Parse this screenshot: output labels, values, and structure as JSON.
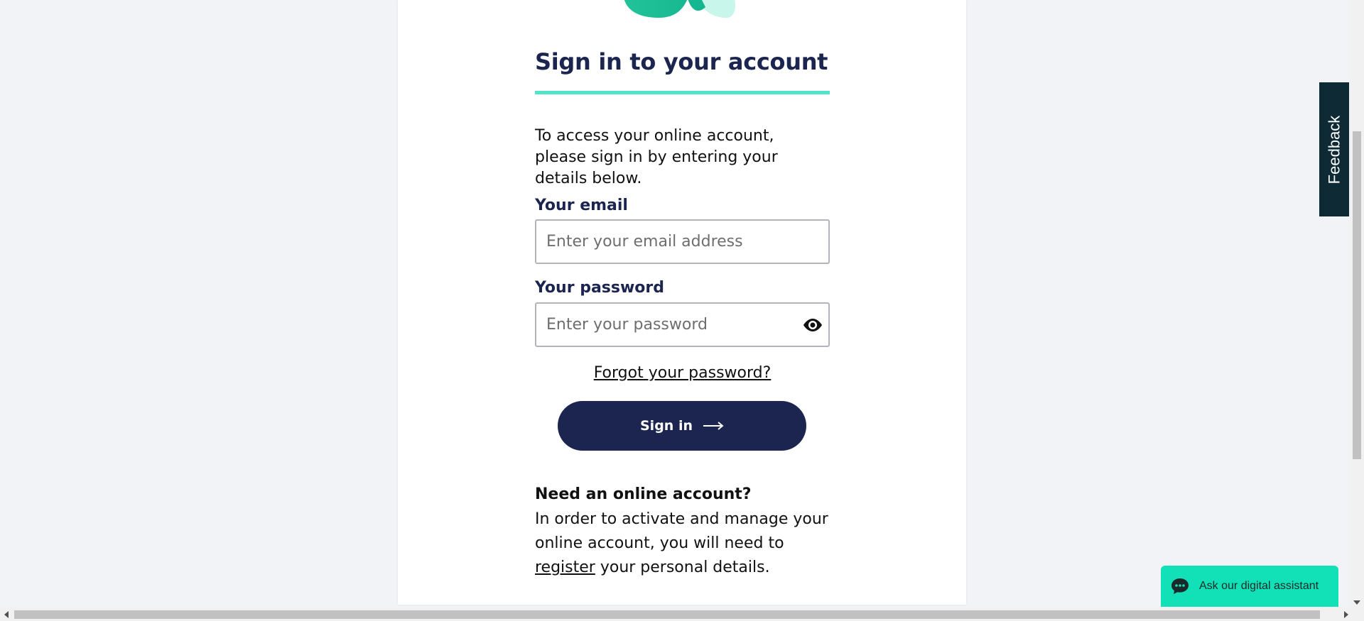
{
  "colors": {
    "navy": "#1b2550",
    "accent": "#51e4c8",
    "assistant_bg": "#12e0b6",
    "feedback_bg": "#0e2a35"
  },
  "logo": {
    "icon": "brand-logo-icon"
  },
  "signin": {
    "title": "Sign in to your account",
    "intro": "To access your online account, please sign in by entering your details below.",
    "email": {
      "label": "Your email",
      "value": "",
      "placeholder": "Enter your email address"
    },
    "password": {
      "label": "Your password",
      "value": "",
      "placeholder": "Enter your password",
      "toggle_icon": "eye-icon"
    },
    "forgot_link": "Forgot your password?",
    "submit_label": "Sign in",
    "submit_icon": "arrow-right-icon"
  },
  "register": {
    "title": "Need an online account?",
    "text_before": "In order to activate and manage your online account, you will need to ",
    "link": "register",
    "text_after": " your personal details."
  },
  "feedback_tab": {
    "label": "Feedback"
  },
  "assistant": {
    "label": "Ask our digital assistant",
    "icon": "chat-bubble-icon"
  }
}
